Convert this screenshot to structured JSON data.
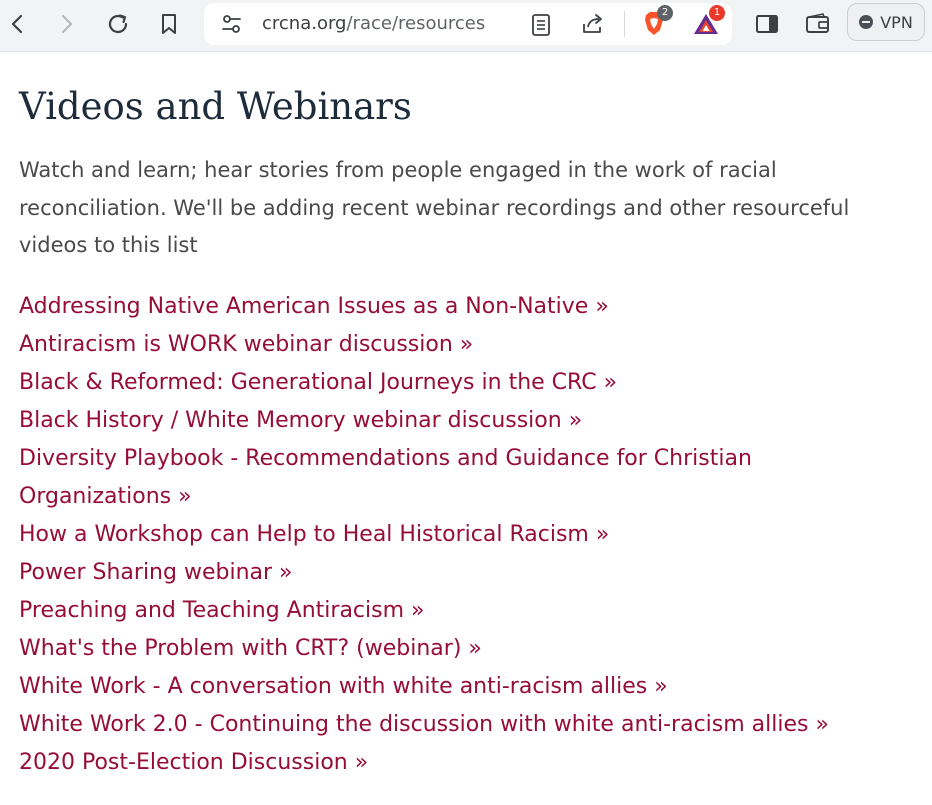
{
  "browser": {
    "url_host": "crcna.org",
    "url_path": "/race/resources",
    "brave_badge": "2",
    "rewards_badge": "1",
    "vpn_label": "VPN"
  },
  "page": {
    "title": "Videos and Webinars",
    "intro": "Watch and learn; hear stories from people engaged in the work of racial reconciliation. We'll be adding recent webinar recordings and other resourceful videos to this list",
    "links": [
      "Addressing Native American Issues as a Non-Native »",
      "Antiracism is WORK webinar discussion »",
      "Black & Reformed: Generational Journeys in the CRC »",
      "Black History / White Memory webinar discussion »",
      "Diversity Playbook - Recommendations and Guidance for Christian Organizations »",
      "How a Workshop can Help to Heal Historical Racism »",
      "Power Sharing webinar »",
      "Preaching and Teaching Antiracism »",
      "What's the Problem with CRT? (webinar) »",
      "White Work - A conversation with white anti-racism allies »",
      "White Work 2.0 - Continuing the discussion with white anti-racism allies »",
      "2020 Post-Election Discussion »"
    ]
  },
  "colors": {
    "link": "#960d36",
    "heading": "#1e2b3a",
    "body_text": "#4a4a4a"
  }
}
